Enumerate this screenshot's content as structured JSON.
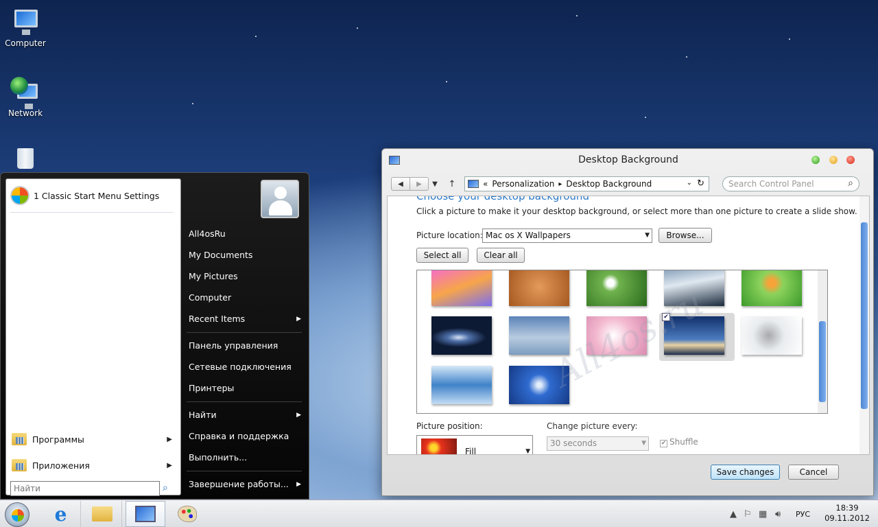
{
  "desktop": {
    "icons": [
      {
        "label": "Computer",
        "icon": "computer-icon"
      },
      {
        "label": "Network",
        "icon": "network-icon"
      },
      {
        "label": "",
        "icon": "recycle-bin-icon"
      }
    ]
  },
  "start_menu": {
    "pinned": "1 Classic Start Menu Settings",
    "programs": "Программы",
    "apps": "Приложения",
    "search_placeholder": "Найти",
    "right": {
      "user": "All4osRu",
      "documents": "My Documents",
      "pictures": "My Pictures",
      "computer": "Computer",
      "recent": "Recent Items",
      "control_panel": "Панель управления",
      "network": "Сетевые подключения",
      "printers": "Принтеры",
      "find": "Найти",
      "help": "Справка и поддержка",
      "run": "Выполнить...",
      "shutdown": "Завершение работы..."
    }
  },
  "window": {
    "title": "Desktop Background",
    "breadcrumb": {
      "chev": "«",
      "parent": "Personalization",
      "sep": "▸",
      "current": "Desktop Background"
    },
    "search_placeholder": "Search Control Panel",
    "heading": "Choose your desktop background",
    "description": "Click a picture to make it your desktop background, or select more than one picture to create a slide show.",
    "location_label": "Picture location:",
    "location_value": "Mac os X  Wallpapers",
    "browse": "Browse...",
    "select_all": "Select all",
    "clear_all": "Clear all",
    "position_label": "Picture position:",
    "position_value": "Fill",
    "change_label": "Change picture every:",
    "change_value": "30 seconds",
    "shuffle": "Shuffle",
    "save": "Save changes",
    "cancel": "Cancel",
    "watermark": "All4os.ru"
  },
  "taskbar": {
    "lang": "РУС",
    "time": "18:39",
    "date": "09.11.2012"
  },
  "colors": {
    "accent": "#2878c8",
    "selection": "#dadada",
    "taskbar": "#e4e6e9"
  }
}
